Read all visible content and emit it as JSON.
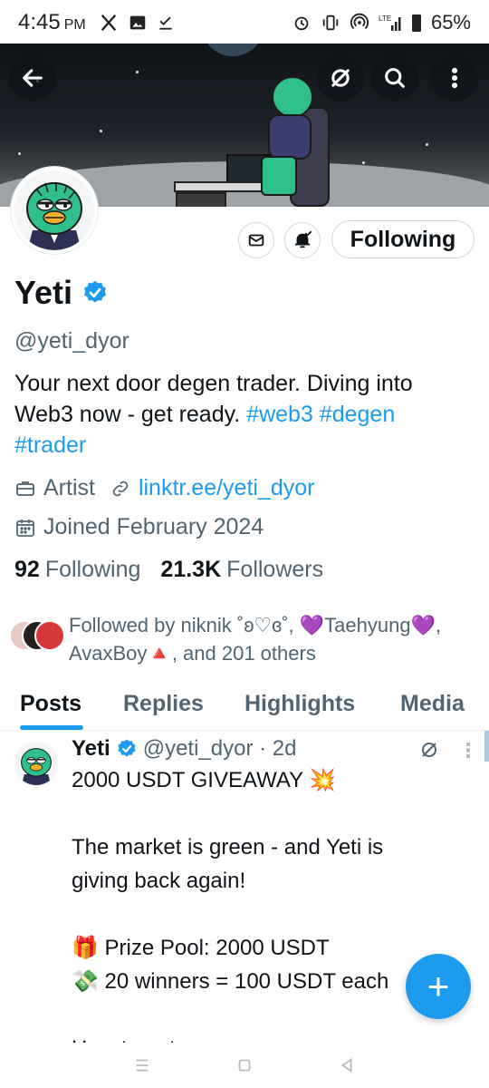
{
  "status_bar": {
    "time": "4:45",
    "ampm": "PM",
    "battery": "65%"
  },
  "banner": {
    "back_icon": "arrow-left-icon",
    "grok_icon": "grok-icon",
    "search_icon": "search-icon",
    "more_icon": "more-vertical-icon"
  },
  "profile": {
    "display_name": "Yeti",
    "handle": "@yeti_dyor",
    "bio_text": "Your next door degen trader. Diving into Web3 now - get ready.",
    "bio_tags": [
      "#web3",
      "#degen",
      "#trader"
    ],
    "category": "Artist",
    "link": "linktr.ee/yeti_dyor",
    "joined": "Joined February 2024",
    "following_count": "92",
    "following_label": "Following",
    "followers_count": "21.3K",
    "followers_label": "Followers",
    "followed_by_text": "Followed by niknik ˚ʚ♡ɞ˚, 💜Taehyung💜, AvaxBoy🔺, and 201 others"
  },
  "actions": {
    "message_icon": "envelope-icon",
    "notify_icon": "bell-icon",
    "follow_label": "Following"
  },
  "tabs": [
    "Posts",
    "Replies",
    "Highlights",
    "Media"
  ],
  "post": {
    "author": "Yeti",
    "handle_time": "@yeti_dyor · 2d",
    "line1": "2000 USDT GIVEAWAY 💥",
    "line2": "The market is green - and Yeti is",
    "line3": "giving back again!",
    "line4": "🎁 Prize Pool: 2000 USDT",
    "line5": "💸 20 winners = 100 USDT each",
    "line6": "How to enter:"
  },
  "fab_label": "+",
  "colors": {
    "accent": "#1d9bf0",
    "text": "#0f1419",
    "muted": "#536471"
  }
}
